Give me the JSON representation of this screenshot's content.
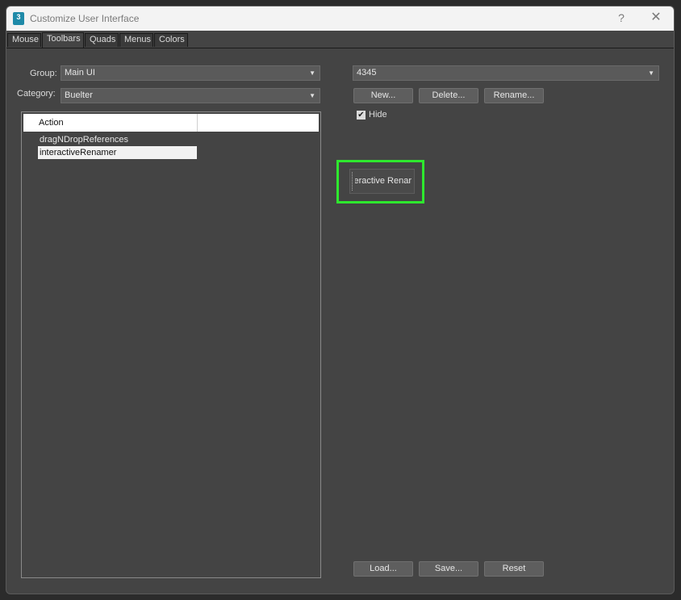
{
  "window": {
    "title": "Customize User Interface",
    "help": "?",
    "close": "✕",
    "icon_text": "3"
  },
  "tabs": [
    "Mouse",
    "Toolbars",
    "Quads",
    "Menus",
    "Colors"
  ],
  "left": {
    "group_label": "Group:",
    "group_value": "Main UI",
    "category_label": "Category:",
    "category_value": "Buelter",
    "list_header": "Action",
    "items": [
      "dragNDropReferences",
      "interactiveRenamer"
    ]
  },
  "right": {
    "toolbar_select": "4345",
    "new_button": "New...",
    "delete_button": "Delete...",
    "rename_button": "Rename...",
    "hide_label": "Hide",
    "hide_checked": true,
    "toolbar_button_label": "eractive Renar",
    "load_button": "Load...",
    "save_button": "Save...",
    "reset_button": "Reset"
  },
  "colors": {
    "highlight": "#2ee82e",
    "background": "#444444"
  }
}
